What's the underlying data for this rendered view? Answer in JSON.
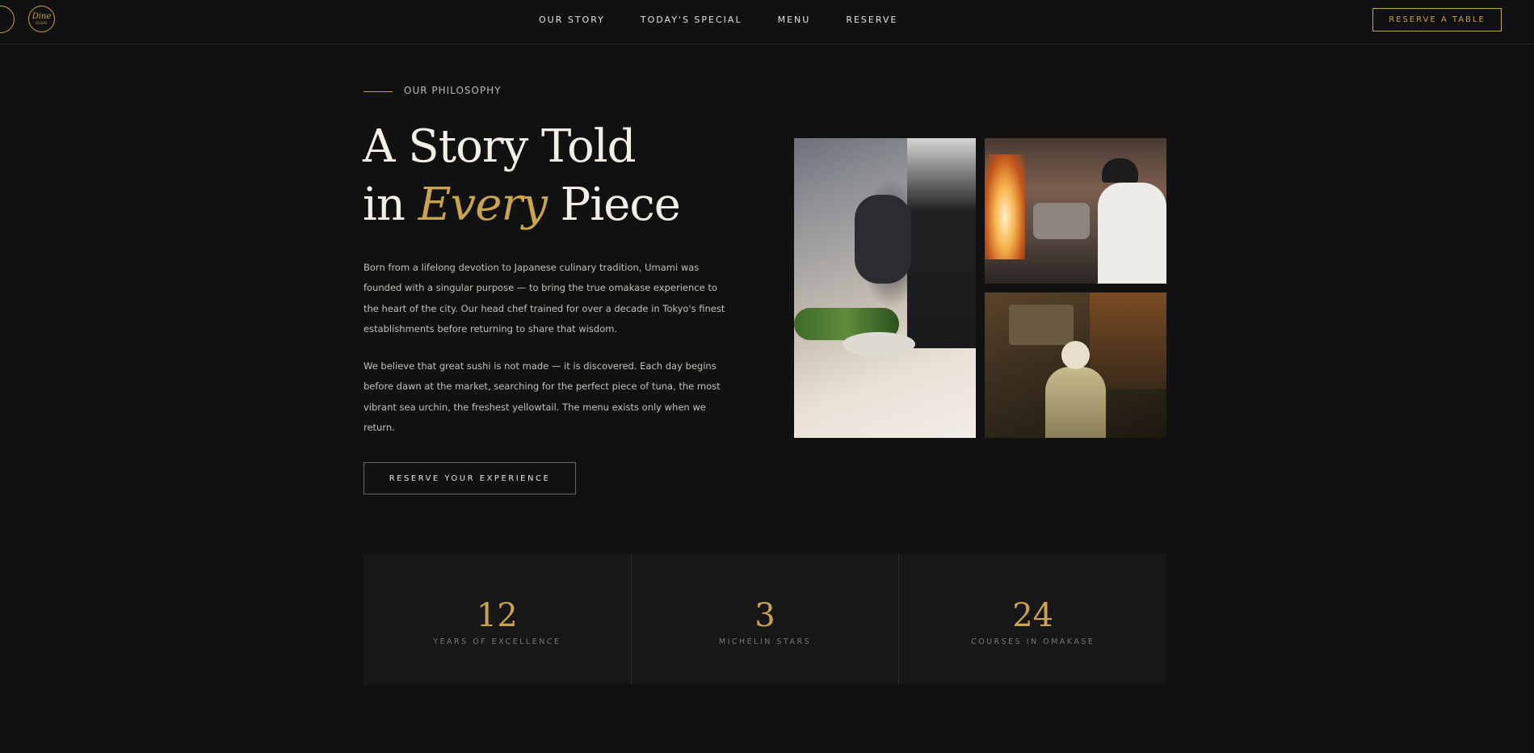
{
  "header": {
    "logo_script": "Dine",
    "logo_small": "SUSHI",
    "nav": [
      "OUR STORY",
      "TODAY'S SPECIAL",
      "MENU",
      "RESERVE"
    ],
    "cta": "RESERVE A TABLE"
  },
  "story": {
    "eyebrow": "OUR PHILOSOPHY",
    "heading_line1": "A Story Told",
    "heading_pre": "in ",
    "heading_accent": "Every",
    "heading_post": " Piece",
    "paragraph1": "Born from a lifelong devotion to Japanese culinary tradition, Umami was founded with a singular purpose — to bring the true omakase experience to the heart of the city. Our head chef trained for over a decade in Tokyo's finest establishments before returning to share that wisdom.",
    "paragraph2": "We believe that great sushi is not made — it is discovered. Each day begins before dawn at the market, searching for the perfect piece of tuna, the most vibrant sea urchin, the freshest yellowtail. The menu exists only when we return.",
    "button": "RESERVE YOUR EXPERIENCE"
  },
  "stats": [
    {
      "number": "12",
      "label": "YEARS OF EXCELLENCE"
    },
    {
      "number": "3",
      "label": "MICHELIN STARS"
    },
    {
      "number": "24",
      "label": "COURSES IN OMAKASE"
    }
  ],
  "colors": {
    "background": "#111111",
    "accent_gold": "#c9a34e",
    "text_light": "#f3efe7",
    "stat_panel": "#171717"
  }
}
